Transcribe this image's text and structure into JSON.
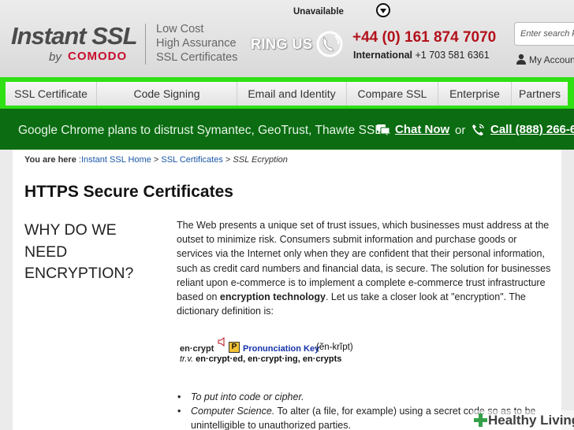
{
  "header": {
    "logo_main": "Instant SSL",
    "logo_by": "by",
    "logo_brand": "COMODO",
    "tagline": [
      "Low Cost",
      "High Assurance",
      "SSL Certificates"
    ],
    "ring_us": "RING US",
    "phone_main": "+44 (0) 161 874 7070",
    "phone_intl_label": "International",
    "phone_intl_number": "+1 703 581 6361",
    "status": "Unavailable",
    "search_placeholder": "Enter search k",
    "account_label": "My Accoun"
  },
  "nav": {
    "items": [
      {
        "label": "SSL Certificate"
      },
      {
        "label": "Code Signing"
      },
      {
        "label": "Email and Identity"
      },
      {
        "label": "Compare SSL"
      },
      {
        "label": "Enterprise"
      },
      {
        "label": "Partners"
      }
    ]
  },
  "banner": {
    "message": "Google Chrome plans to distrust Symantec, GeoTrust, Thawte SSLs.",
    "chat_label": "Chat Now",
    "or_text": "or",
    "call_label": "Call (888) 266-6"
  },
  "breadcrumb": {
    "prefix": "You are here",
    "sep_colon": ":",
    "items": [
      "Instant SSL Home",
      "SSL Certificates"
    ],
    "separator": ">",
    "current": "SSL Ecryption"
  },
  "main": {
    "title": "HTTPS Secure Certificates",
    "heading_lines": [
      "WHY DO WE",
      "NEED",
      "ENCRYPTION?"
    ],
    "paragraph_part1": "The Web presents a unique set of trust issues, which businesses must address at the outset to minimize risk. Consumers submit information and purchase goods or services via the Internet only when they are confident that their personal information, such as credit card numbers and financial data, is secure. The solution for businesses reliant upon e-commerce is to implement a complete e-commerce trust infrastructure based on",
    "paragraph_bold": "encryption technology",
    "paragraph_part2": ". Let us take a closer look at \"encryption\". The dictionary definition is:",
    "dictionary": {
      "word": "en·crypt",
      "pronunciation_key": "Pronunciation Key",
      "pronunciation": "(ĕn-krĭpt)",
      "pos": "tr.v.",
      "forms": "en·crypt·ed, en·crypt·ing, en·crypts"
    },
    "definitions": [
      {
        "text": "To put into code or cipher."
      },
      {
        "prefix": "Computer Science.",
        "text": " To alter (a file, for example) using a secret code so as to be unintelligible to unauthorized parties."
      }
    ]
  },
  "watermark": "Healthy Living",
  "colors": {
    "nav_highlight": "#2fe014",
    "banner_bg": "#0b6c12",
    "brand_red": "#c8102e",
    "phone_red": "#b3111b",
    "link_blue": "#1a57a8"
  }
}
